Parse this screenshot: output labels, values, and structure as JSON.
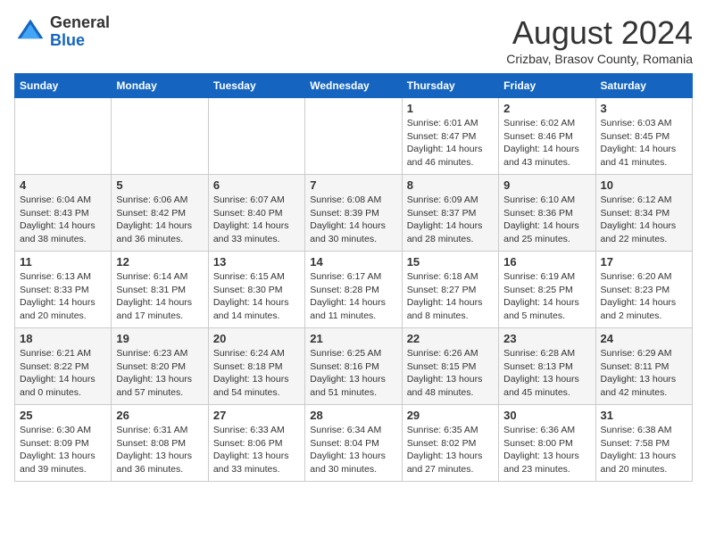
{
  "logo": {
    "general": "General",
    "blue": "Blue"
  },
  "title": "August 2024",
  "location": "Crizbav, Brasov County, Romania",
  "days_of_week": [
    "Sunday",
    "Monday",
    "Tuesday",
    "Wednesday",
    "Thursday",
    "Friday",
    "Saturday"
  ],
  "weeks": [
    [
      {
        "day": "",
        "info": ""
      },
      {
        "day": "",
        "info": ""
      },
      {
        "day": "",
        "info": ""
      },
      {
        "day": "",
        "info": ""
      },
      {
        "day": "1",
        "info": "Sunrise: 6:01 AM\nSunset: 8:47 PM\nDaylight: 14 hours and 46 minutes."
      },
      {
        "day": "2",
        "info": "Sunrise: 6:02 AM\nSunset: 8:46 PM\nDaylight: 14 hours and 43 minutes."
      },
      {
        "day": "3",
        "info": "Sunrise: 6:03 AM\nSunset: 8:45 PM\nDaylight: 14 hours and 41 minutes."
      }
    ],
    [
      {
        "day": "4",
        "info": "Sunrise: 6:04 AM\nSunset: 8:43 PM\nDaylight: 14 hours and 38 minutes."
      },
      {
        "day": "5",
        "info": "Sunrise: 6:06 AM\nSunset: 8:42 PM\nDaylight: 14 hours and 36 minutes."
      },
      {
        "day": "6",
        "info": "Sunrise: 6:07 AM\nSunset: 8:40 PM\nDaylight: 14 hours and 33 minutes."
      },
      {
        "day": "7",
        "info": "Sunrise: 6:08 AM\nSunset: 8:39 PM\nDaylight: 14 hours and 30 minutes."
      },
      {
        "day": "8",
        "info": "Sunrise: 6:09 AM\nSunset: 8:37 PM\nDaylight: 14 hours and 28 minutes."
      },
      {
        "day": "9",
        "info": "Sunrise: 6:10 AM\nSunset: 8:36 PM\nDaylight: 14 hours and 25 minutes."
      },
      {
        "day": "10",
        "info": "Sunrise: 6:12 AM\nSunset: 8:34 PM\nDaylight: 14 hours and 22 minutes."
      }
    ],
    [
      {
        "day": "11",
        "info": "Sunrise: 6:13 AM\nSunset: 8:33 PM\nDaylight: 14 hours and 20 minutes."
      },
      {
        "day": "12",
        "info": "Sunrise: 6:14 AM\nSunset: 8:31 PM\nDaylight: 14 hours and 17 minutes."
      },
      {
        "day": "13",
        "info": "Sunrise: 6:15 AM\nSunset: 8:30 PM\nDaylight: 14 hours and 14 minutes."
      },
      {
        "day": "14",
        "info": "Sunrise: 6:17 AM\nSunset: 8:28 PM\nDaylight: 14 hours and 11 minutes."
      },
      {
        "day": "15",
        "info": "Sunrise: 6:18 AM\nSunset: 8:27 PM\nDaylight: 14 hours and 8 minutes."
      },
      {
        "day": "16",
        "info": "Sunrise: 6:19 AM\nSunset: 8:25 PM\nDaylight: 14 hours and 5 minutes."
      },
      {
        "day": "17",
        "info": "Sunrise: 6:20 AM\nSunset: 8:23 PM\nDaylight: 14 hours and 2 minutes."
      }
    ],
    [
      {
        "day": "18",
        "info": "Sunrise: 6:21 AM\nSunset: 8:22 PM\nDaylight: 14 hours and 0 minutes."
      },
      {
        "day": "19",
        "info": "Sunrise: 6:23 AM\nSunset: 8:20 PM\nDaylight: 13 hours and 57 minutes."
      },
      {
        "day": "20",
        "info": "Sunrise: 6:24 AM\nSunset: 8:18 PM\nDaylight: 13 hours and 54 minutes."
      },
      {
        "day": "21",
        "info": "Sunrise: 6:25 AM\nSunset: 8:16 PM\nDaylight: 13 hours and 51 minutes."
      },
      {
        "day": "22",
        "info": "Sunrise: 6:26 AM\nSunset: 8:15 PM\nDaylight: 13 hours and 48 minutes."
      },
      {
        "day": "23",
        "info": "Sunrise: 6:28 AM\nSunset: 8:13 PM\nDaylight: 13 hours and 45 minutes."
      },
      {
        "day": "24",
        "info": "Sunrise: 6:29 AM\nSunset: 8:11 PM\nDaylight: 13 hours and 42 minutes."
      }
    ],
    [
      {
        "day": "25",
        "info": "Sunrise: 6:30 AM\nSunset: 8:09 PM\nDaylight: 13 hours and 39 minutes."
      },
      {
        "day": "26",
        "info": "Sunrise: 6:31 AM\nSunset: 8:08 PM\nDaylight: 13 hours and 36 minutes."
      },
      {
        "day": "27",
        "info": "Sunrise: 6:33 AM\nSunset: 8:06 PM\nDaylight: 13 hours and 33 minutes."
      },
      {
        "day": "28",
        "info": "Sunrise: 6:34 AM\nSunset: 8:04 PM\nDaylight: 13 hours and 30 minutes."
      },
      {
        "day": "29",
        "info": "Sunrise: 6:35 AM\nSunset: 8:02 PM\nDaylight: 13 hours and 27 minutes."
      },
      {
        "day": "30",
        "info": "Sunrise: 6:36 AM\nSunset: 8:00 PM\nDaylight: 13 hours and 23 minutes."
      },
      {
        "day": "31",
        "info": "Sunrise: 6:38 AM\nSunset: 7:58 PM\nDaylight: 13 hours and 20 minutes."
      }
    ]
  ]
}
